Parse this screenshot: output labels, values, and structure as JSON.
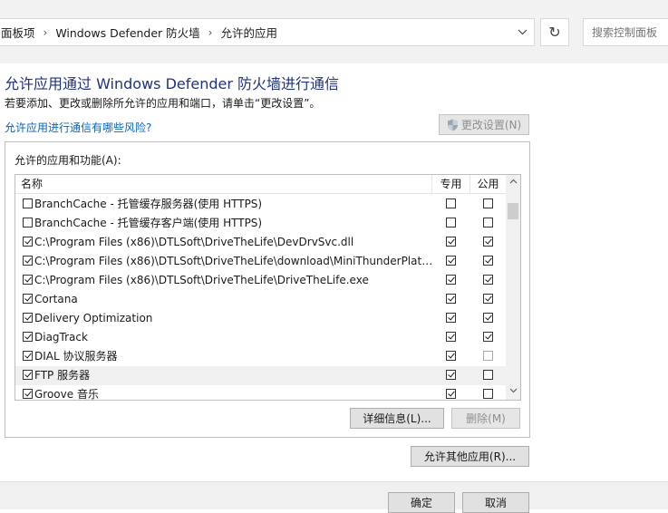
{
  "breadcrumb": {
    "items": [
      "面板项",
      "Windows Defender 防火墙",
      "允许的应用"
    ],
    "separator": "›",
    "dropdown_icon": "chevron-down-icon"
  },
  "refresh_icon": "↻",
  "search": {
    "placeholder": "搜索控制面板"
  },
  "page": {
    "title": "允许应用通过 Windows Defender 防火墙进行通信",
    "subtitle": "若要添加、更改或删除所允许的应用和端口，请单击“更改设置”。",
    "risk_link": "允许应用进行通信有哪些风险?",
    "change_settings_label": "更改设置(N)"
  },
  "apps": {
    "group_label": "允许的应用和功能(A):",
    "columns": {
      "name": "名称",
      "private": "专用",
      "public": "公用"
    },
    "rows": [
      {
        "name": "BranchCache - 托管缓存服务器(使用 HTTPS)",
        "enabled": false,
        "private": false,
        "public": false
      },
      {
        "name": "BranchCache - 托管缓存客户端(使用 HTTPS)",
        "enabled": false,
        "private": false,
        "public": false
      },
      {
        "name": "C:\\Program Files (x86)\\DTLSoft\\DriveTheLife\\DevDrvSvc.dll",
        "enabled": true,
        "private": true,
        "public": true
      },
      {
        "name": "C:\\Program Files (x86)\\DTLSoft\\DriveTheLife\\download\\MiniThunderPlatfo...",
        "enabled": true,
        "private": true,
        "public": true
      },
      {
        "name": "C:\\Program Files (x86)\\DTLSoft\\DriveTheLife\\DriveTheLife.exe",
        "enabled": true,
        "private": true,
        "public": true
      },
      {
        "name": "Cortana",
        "enabled": true,
        "private": true,
        "public": true
      },
      {
        "name": "Delivery Optimization",
        "enabled": true,
        "private": true,
        "public": true
      },
      {
        "name": "DiagTrack",
        "enabled": true,
        "private": true,
        "public": true
      },
      {
        "name": "DIAL 协议服务器",
        "enabled": true,
        "private": true,
        "public": false
      },
      {
        "name": "FTP 服务器",
        "enabled": true,
        "private": true,
        "public": false
      },
      {
        "name": "Groove 音乐",
        "enabled": true,
        "private": true,
        "public": false
      }
    ],
    "selected_index": 9,
    "details_label": "详细信息(L)...",
    "delete_label": "删除(M)"
  },
  "allow_other_label": "允许其他应用(R)...",
  "dialog": {
    "ok_label": "确定",
    "cancel_label": "取消"
  }
}
